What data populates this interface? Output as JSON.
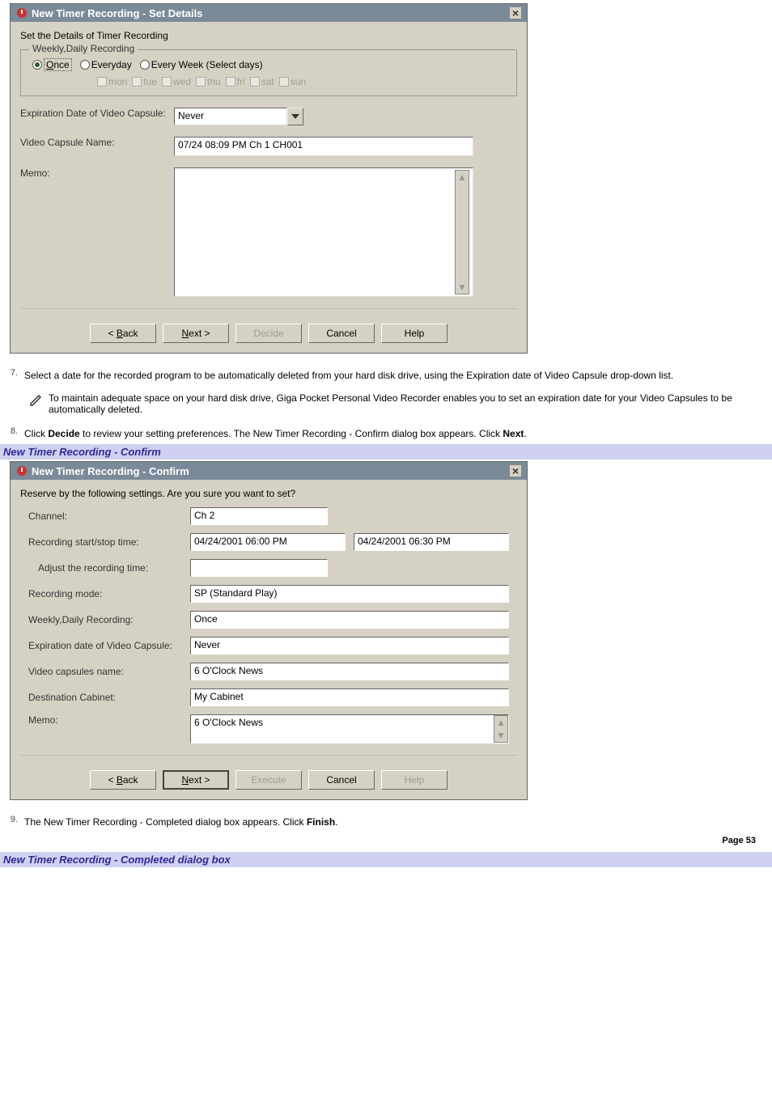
{
  "dialog1": {
    "title": "New Timer Recording - Set Details",
    "subtitle": "Set the Details of Timer Recording",
    "group_legend": "Weekly,Daily Recording",
    "radios": {
      "once": "Once",
      "everyday": "Everyday",
      "selectdays": "Every Week (Select days)"
    },
    "days": {
      "mon": "mon",
      "tue": "tue",
      "wed": "wed",
      "thu": "thu",
      "fri": "fri",
      "sat": "sat",
      "sun": "sun"
    },
    "expiration_label": "Expiration Date of Video Capsule:",
    "expiration_value": "Never",
    "capsule_name_label": "Video Capsule Name:",
    "capsule_name_value": "07/24 08:09 PM Ch 1 CH001",
    "memo_label": "Memo:",
    "buttons": {
      "back": "< Back",
      "next": "Next >",
      "decide": "Decide",
      "cancel": "Cancel",
      "help": "Help"
    }
  },
  "step7": {
    "num": "7.",
    "text": "Select a date for the recorded program to be automatically deleted from your hard disk drive, using the Expiration date of Video Capsule drop-down list."
  },
  "note7": "To maintain adequate space on your hard disk drive, Giga Pocket Personal Video Recorder enables you to set an expiration date for your Video Capsules to be automatically deleted.",
  "step8": {
    "num": "8.",
    "prefix": "Click ",
    "bold1": "Decide",
    "mid": " to review your setting preferences. The New Timer Recording - Confirm dialog box appears. Click ",
    "bold2": "Next",
    "suffix": "."
  },
  "heading_confirm": "New Timer Recording - Confirm",
  "dialog2": {
    "title": "New Timer Recording - Confirm",
    "subtitle": "Reserve by the following settings. Are you sure you want to set?",
    "channel_label": "Channel:",
    "channel_value": "Ch 2",
    "startstop_label": "Recording start/stop time:",
    "start_value": "04/24/2001 06:00 PM",
    "stop_value": "04/24/2001 06:30 PM",
    "adjust_label": "Adjust the recording time:",
    "adjust_value": "",
    "mode_label": "Recording mode:",
    "mode_value": "SP (Standard Play)",
    "weekly_label": "Weekly,Daily Recording:",
    "weekly_value": "Once",
    "expiration_label": "Expiration date of Video Capsule:",
    "expiration_value": "Never",
    "capsules_label": "Video capsules name:",
    "capsules_value": "6 O'Clock News",
    "dest_label": "Destination Cabinet:",
    "dest_value": "My Cabinet",
    "memo_label": "Memo:",
    "memo_value": "6 O'Clock News",
    "buttons": {
      "back": "< Back",
      "next": "Next >",
      "execute": "Execute",
      "cancel": "Cancel",
      "help": "Help"
    }
  },
  "step9": {
    "num": "9.",
    "prefix": "The New Timer Recording - Completed dialog box appears. Click ",
    "bold": "Finish",
    "suffix": "."
  },
  "heading_completed": "New Timer Recording - Completed dialog box",
  "page_footer": "Page 53"
}
